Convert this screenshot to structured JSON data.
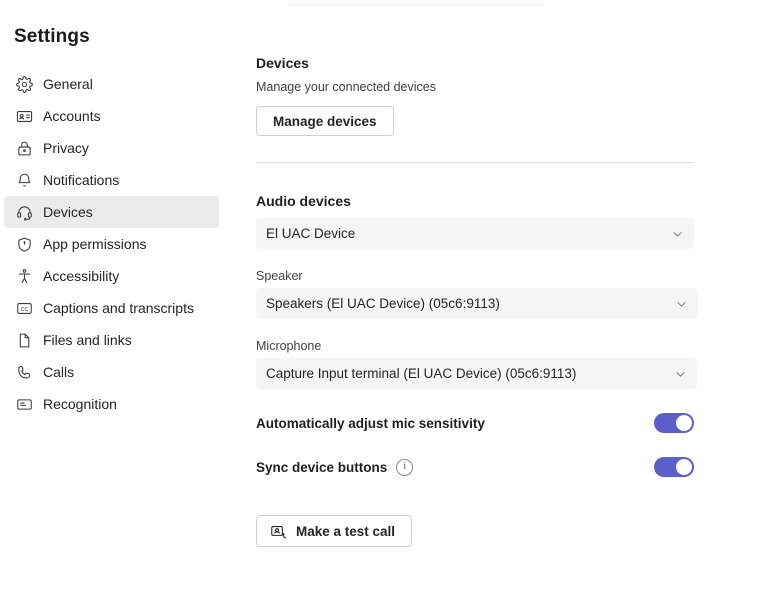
{
  "sidebar": {
    "title": "Settings",
    "items": [
      {
        "label": "General",
        "icon": "gear-icon",
        "selected": false
      },
      {
        "label": "Accounts",
        "icon": "contact-card-icon",
        "selected": false
      },
      {
        "label": "Privacy",
        "icon": "lock-icon",
        "selected": false
      },
      {
        "label": "Notifications",
        "icon": "bell-icon",
        "selected": false
      },
      {
        "label": "Devices",
        "icon": "headset-icon",
        "selected": true
      },
      {
        "label": "App permissions",
        "icon": "shield-icon",
        "selected": false
      },
      {
        "label": "Accessibility",
        "icon": "accessibility-icon",
        "selected": false
      },
      {
        "label": "Captions and transcripts",
        "icon": "cc-icon",
        "selected": false
      },
      {
        "label": "Files and links",
        "icon": "document-icon",
        "selected": false
      },
      {
        "label": "Calls",
        "icon": "phone-icon",
        "selected": false
      },
      {
        "label": "Recognition",
        "icon": "recognition-icon",
        "selected": false
      }
    ]
  },
  "main": {
    "devices": {
      "title": "Devices",
      "subtitle": "Manage your connected devices",
      "manage_button": "Manage devices"
    },
    "audio": {
      "title": "Audio devices",
      "device_value": "El UAC Device",
      "speaker_label": "Speaker",
      "speaker_value": "Speakers (El UAC Device) (05c6:9113)",
      "microphone_label": "Microphone",
      "microphone_value": "Capture Input terminal (El UAC Device) (05c6:9113)"
    },
    "toggles": [
      {
        "label": "Automatically adjust mic sensitivity",
        "state": "on",
        "has_info": false
      },
      {
        "label": "Sync device buttons",
        "state": "on",
        "has_info": true
      }
    ],
    "test_call_button": "Make a test call"
  },
  "colors": {
    "toggle_on": "#5b5fc7",
    "selected_row": "#ebebeb",
    "field_bg": "#f5f5f5",
    "divider": "#e0e0e0"
  }
}
